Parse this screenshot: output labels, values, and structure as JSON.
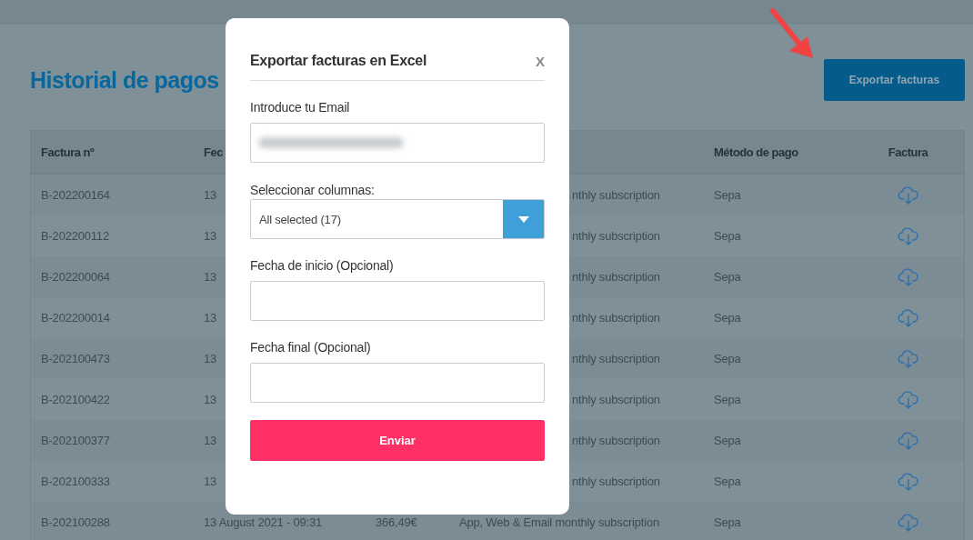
{
  "page": {
    "title": "Historial de pagos",
    "export_button": "Exportar facturas"
  },
  "table": {
    "columns": [
      "Factura nº",
      "Fec",
      "Método de pago",
      "Factura"
    ],
    "rows": [
      {
        "invoice": "B-202200164",
        "column_2": "13",
        "column_4": "nthly subscription",
        "payment_method": "Sepa"
      },
      {
        "invoice": "B-202200112",
        "column_2": "13",
        "column_4": "nthly subscription",
        "payment_method": "Sepa"
      },
      {
        "invoice": "B-202200064",
        "column_2": "13",
        "column_4": "nthly subscription",
        "payment_method": "Sepa"
      },
      {
        "invoice": "B-202200014",
        "column_2": "13",
        "column_4": "nthly subscription",
        "payment_method": "Sepa"
      },
      {
        "invoice": "B-202100473",
        "column_2": "13",
        "column_4": "nthly subscription",
        "payment_method": "Sepa"
      },
      {
        "invoice": "B-202100422",
        "column_2": "13",
        "column_4": "nthly subscription",
        "payment_method": "Sepa"
      },
      {
        "invoice": "B-202100377",
        "column_2": "13",
        "column_4": "nthly subscription",
        "payment_method": "Sepa"
      },
      {
        "invoice": "B-202100333",
        "column_2": "13",
        "column_4": "nthly subscription",
        "payment_method": "Sepa"
      },
      {
        "invoice": "B-202100288",
        "column_2": "13 August 2021 - 09:31",
        "column_3": "366,49€",
        "column_4": "App, Web & Email monthly subscription",
        "payment_method": "Sepa"
      }
    ]
  },
  "modal": {
    "title": "Exportar facturas en Excel",
    "close": "X",
    "fields": [
      {
        "kind": "email",
        "label": "Introduce tu Email",
        "value_redacted": true
      },
      {
        "kind": "select",
        "label": "Seleccionar columnas:",
        "value": "All selected (17)"
      },
      {
        "kind": "text",
        "label": "Fecha de inicio (Opcional)"
      },
      {
        "kind": "text",
        "label": "Fecha final (Opcional)"
      }
    ],
    "submit": "Enviar"
  }
}
